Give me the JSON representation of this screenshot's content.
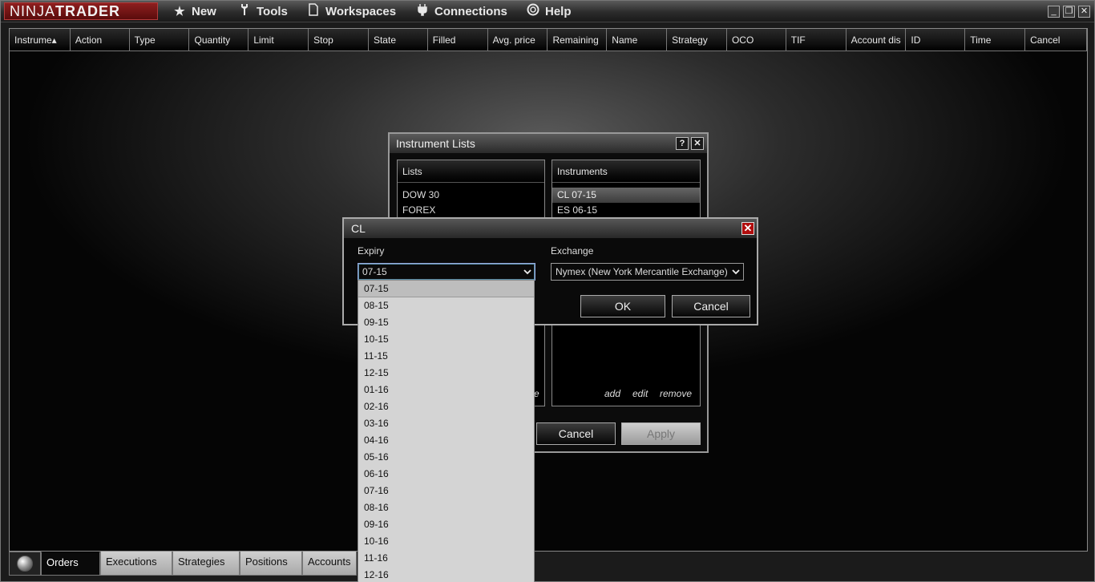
{
  "topbar": {
    "logo_a": "NINJA",
    "logo_b": "TRADER",
    "menu": [
      {
        "label": "New",
        "icon": "star-icon"
      },
      {
        "label": "Tools",
        "icon": "wrench-icon"
      },
      {
        "label": "Workspaces",
        "icon": "document-icon"
      },
      {
        "label": "Connections",
        "icon": "plug-icon"
      },
      {
        "label": "Help",
        "icon": "lifebuoy-icon"
      }
    ],
    "window_buttons": {
      "minimize": "_",
      "restore": "❐",
      "close": "✕"
    }
  },
  "grid": {
    "columns": [
      "Instrume▴",
      "Action",
      "Type",
      "Quantity",
      "Limit",
      "Stop",
      "State",
      "Filled",
      "Avg. price",
      "Remaining",
      "Name",
      "Strategy",
      "OCO",
      "TIF",
      "Account dis",
      "ID",
      "Time",
      "Cancel"
    ]
  },
  "tabs": [
    "Orders",
    "Executions",
    "Strategies",
    "Positions",
    "Accounts"
  ],
  "instrument_lists": {
    "title": "Instrument Lists",
    "help": "?",
    "close": "✕",
    "lists_header": "Lists",
    "lists": [
      "DOW 30",
      "FOREX"
    ],
    "instruments_header": "Instruments",
    "instruments": [
      "CL 07-15",
      "ES 06-15"
    ],
    "left_partial_link": "e",
    "links": {
      "add": "add",
      "edit": "edit",
      "remove": "remove"
    },
    "cancel_label": "Cancel",
    "apply_label": "Apply"
  },
  "cl_dialog": {
    "title": "CL",
    "close": "✕",
    "expiry_label": "Expiry",
    "expiry_value": "07-15",
    "exchange_label": "Exchange",
    "exchange_value": "Nymex (New York Mercantile Exchange)",
    "ok_label": "OK",
    "cancel_label": "Cancel"
  },
  "expiry_options": [
    "07-15",
    "08-15",
    "09-15",
    "10-15",
    "11-15",
    "12-15",
    "01-16",
    "02-16",
    "03-16",
    "04-16",
    "05-16",
    "06-16",
    "07-16",
    "08-16",
    "09-16",
    "10-16",
    "11-16",
    "12-16"
  ]
}
